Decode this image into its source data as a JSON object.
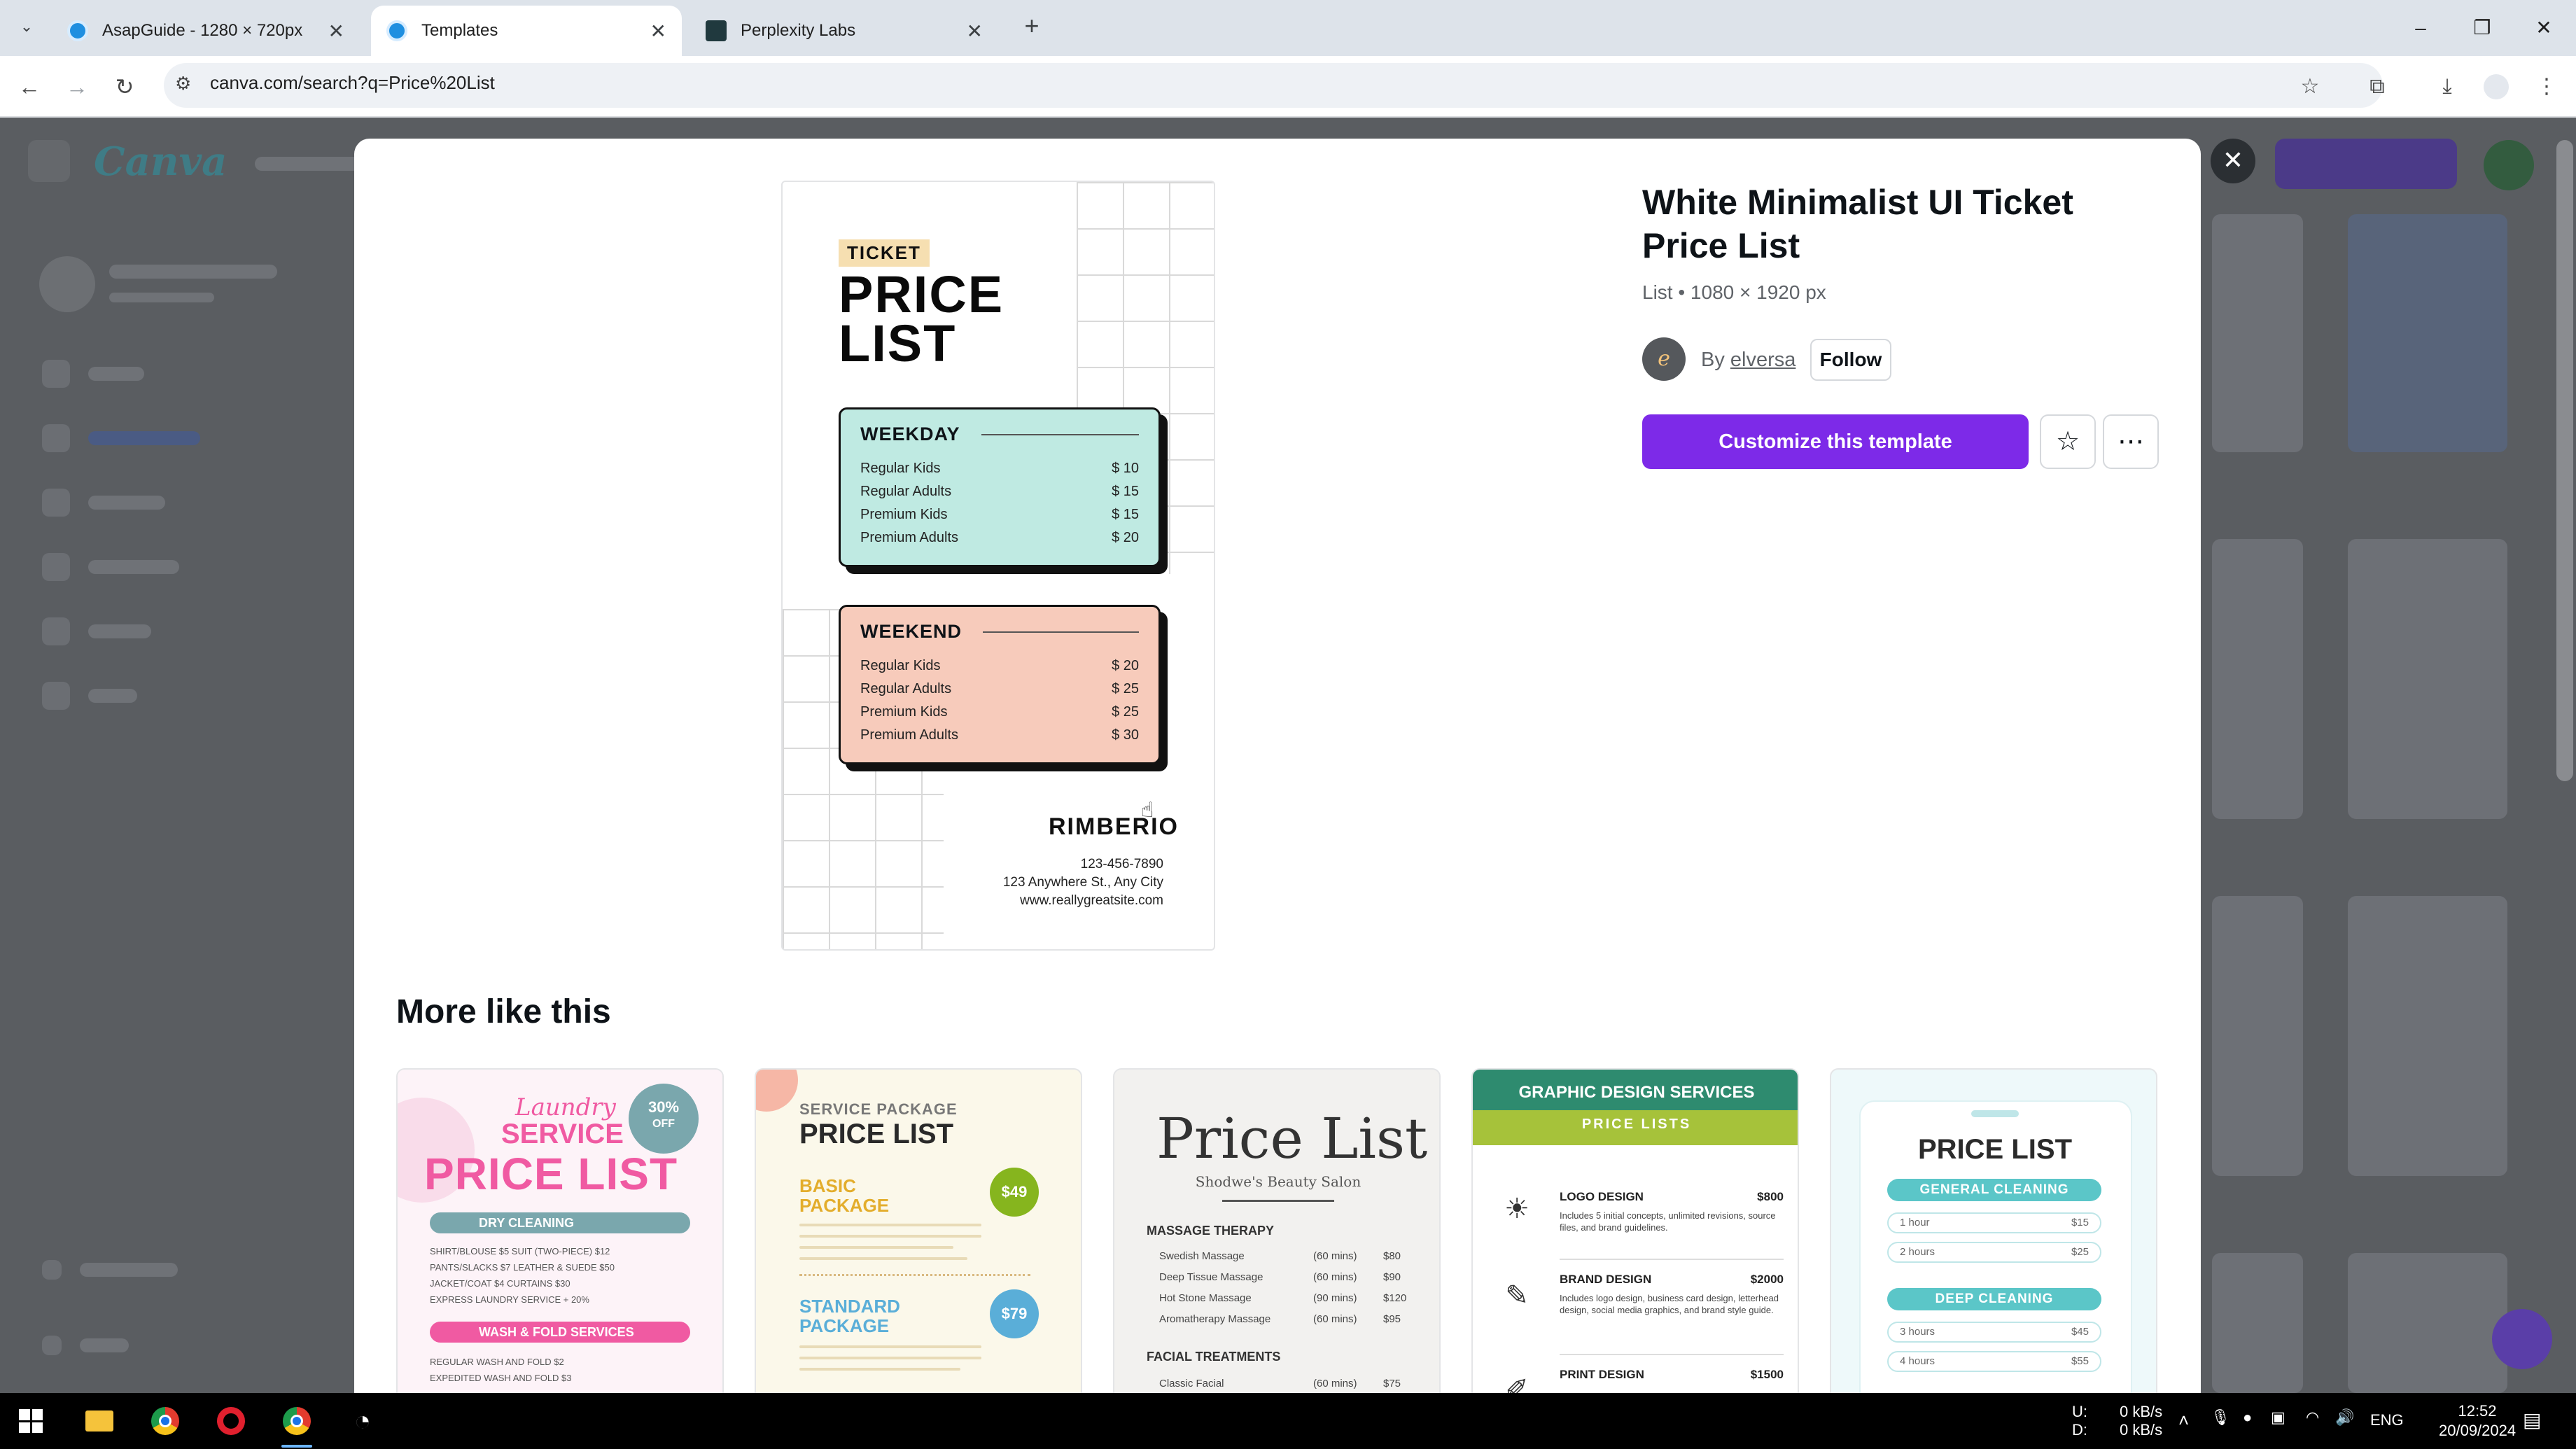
{
  "browser": {
    "tabs": [
      {
        "title": "AsapGuide - 1280 × 720px",
        "favicon": "canva-icon"
      },
      {
        "title": "Templates",
        "favicon": "canva-icon",
        "active": true
      },
      {
        "title": "Perplexity Labs",
        "favicon": "perplexity-icon"
      }
    ],
    "url": "canva.com/search?q=Price%20List"
  },
  "template": {
    "title": "White Minimalist UI Ticket Price List",
    "meta": "List • 1080 × 1920 px",
    "by_prefix": "By ",
    "author": "elversa",
    "follow_label": "Follow",
    "customize_label": "Customize this template"
  },
  "preview": {
    "tag": "TICKET",
    "title_line1": "PRICE",
    "title_line2": "LIST",
    "weekday": {
      "heading": "WEEKDAY",
      "rows": [
        {
          "name": "Regular Kids",
          "price": "$ 10"
        },
        {
          "name": "Regular Adults",
          "price": "$ 15"
        },
        {
          "name": "Premium Kids",
          "price": "$ 15"
        },
        {
          "name": "Premium Adults",
          "price": "$ 20"
        }
      ]
    },
    "weekend": {
      "heading": "WEEKEND",
      "rows": [
        {
          "name": "Regular Kids",
          "price": "$ 20"
        },
        {
          "name": "Regular Adults",
          "price": "$ 25"
        },
        {
          "name": "Premium Kids",
          "price": "$ 25"
        },
        {
          "name": "Premium Adults",
          "price": "$ 30"
        }
      ]
    },
    "brand": "RIMBERIO",
    "phone": "123-456-7890",
    "address": "123 Anywhere St., Any City",
    "website": "www.reallygreatsite.com"
  },
  "more_like_this": {
    "heading": "More like this",
    "laundry": {
      "script": "Laundry",
      "service": "SERVICE",
      "badge_pct": "30%",
      "badge_off": "OFF",
      "big": "PRICE LIST",
      "band1": "DRY CLEANING",
      "rows1": [
        "SHIRT/BLOUSE $5   SUIT (TWO-PIECE) $12",
        "PANTS/SLACKS $7   LEATHER & SUEDE $50",
        "JACKET/COAT $4   CURTAINS $30",
        "EXPRESS LAUNDRY SERVICE + 20%"
      ],
      "band2": "WASH & FOLD SERVICES",
      "rows2": [
        "REGULAR WASH AND FOLD $2",
        "EXPEDITED WASH AND FOLD $3"
      ]
    },
    "package": {
      "sub": "SERVICE PACKAGE",
      "title": "PRICE LIST",
      "basic_l1": "BASIC",
      "basic_l2": "PACKAGE",
      "basic_price": "$49",
      "standard_l1": "STANDARD",
      "standard_l2": "PACKAGE",
      "standard_price": "$79"
    },
    "beauty": {
      "title": "Price List",
      "subtitle": "Shodwe's Beauty Salon",
      "section1": "MASSAGE THERAPY",
      "rows": [
        {
          "name": "Swedish Massage",
          "dur": "(60 mins)",
          "price": "$80"
        },
        {
          "name": "Deep Tissue Massage",
          "dur": "(60 mins)",
          "price": "$90"
        },
        {
          "name": "Hot Stone Massage",
          "dur": "(90 mins)",
          "price": "$120"
        },
        {
          "name": "Aromatherapy Massage",
          "dur": "(60 mins)",
          "price": "$95"
        }
      ],
      "section2": "FACIAL TREATMENTS",
      "row_facial": {
        "name": "Classic Facial",
        "dur": "(60 mins)",
        "price": "$75"
      }
    },
    "graphic": {
      "title": "GRAPHIC DESIGN SERVICES",
      "band": "PRICE LISTS",
      "items": [
        {
          "name": "LOGO DESIGN",
          "price": "$800",
          "desc": "Includes 5 initial concepts, unlimited revisions, source files, and brand guidelines."
        },
        {
          "name": "BRAND DESIGN",
          "price": "$2000",
          "desc": "Includes logo design, business card design, letterhead design, social media graphics, and brand style guide."
        },
        {
          "name": "PRINT DESIGN",
          "price": "$1500",
          "desc": ""
        }
      ]
    },
    "cleaning": {
      "title": "PRICE LIST",
      "pill1": "GENERAL CLEANING",
      "rows1": [
        {
          "label": "1 hour",
          "price": "$15"
        },
        {
          "label": "2 hours",
          "price": "$25"
        }
      ],
      "pill2": "DEEP CLEANING",
      "rows2": [
        {
          "label": "3 hours",
          "price": "$45"
        },
        {
          "label": "4 hours",
          "price": "$55"
        }
      ]
    }
  },
  "taskbar": {
    "net_up_label": "U:",
    "net_down_label": "D:",
    "net_up": "0 kB/s",
    "net_down": "0 kB/s",
    "lang": "ENG",
    "time": "12:52",
    "date": "20/09/2024"
  },
  "colors": {
    "accent": "#7d2ae8",
    "weekday_card": "#bfeae2",
    "weekend_card": "#f7cbbb",
    "ticket_tag": "#f6dfb1"
  }
}
